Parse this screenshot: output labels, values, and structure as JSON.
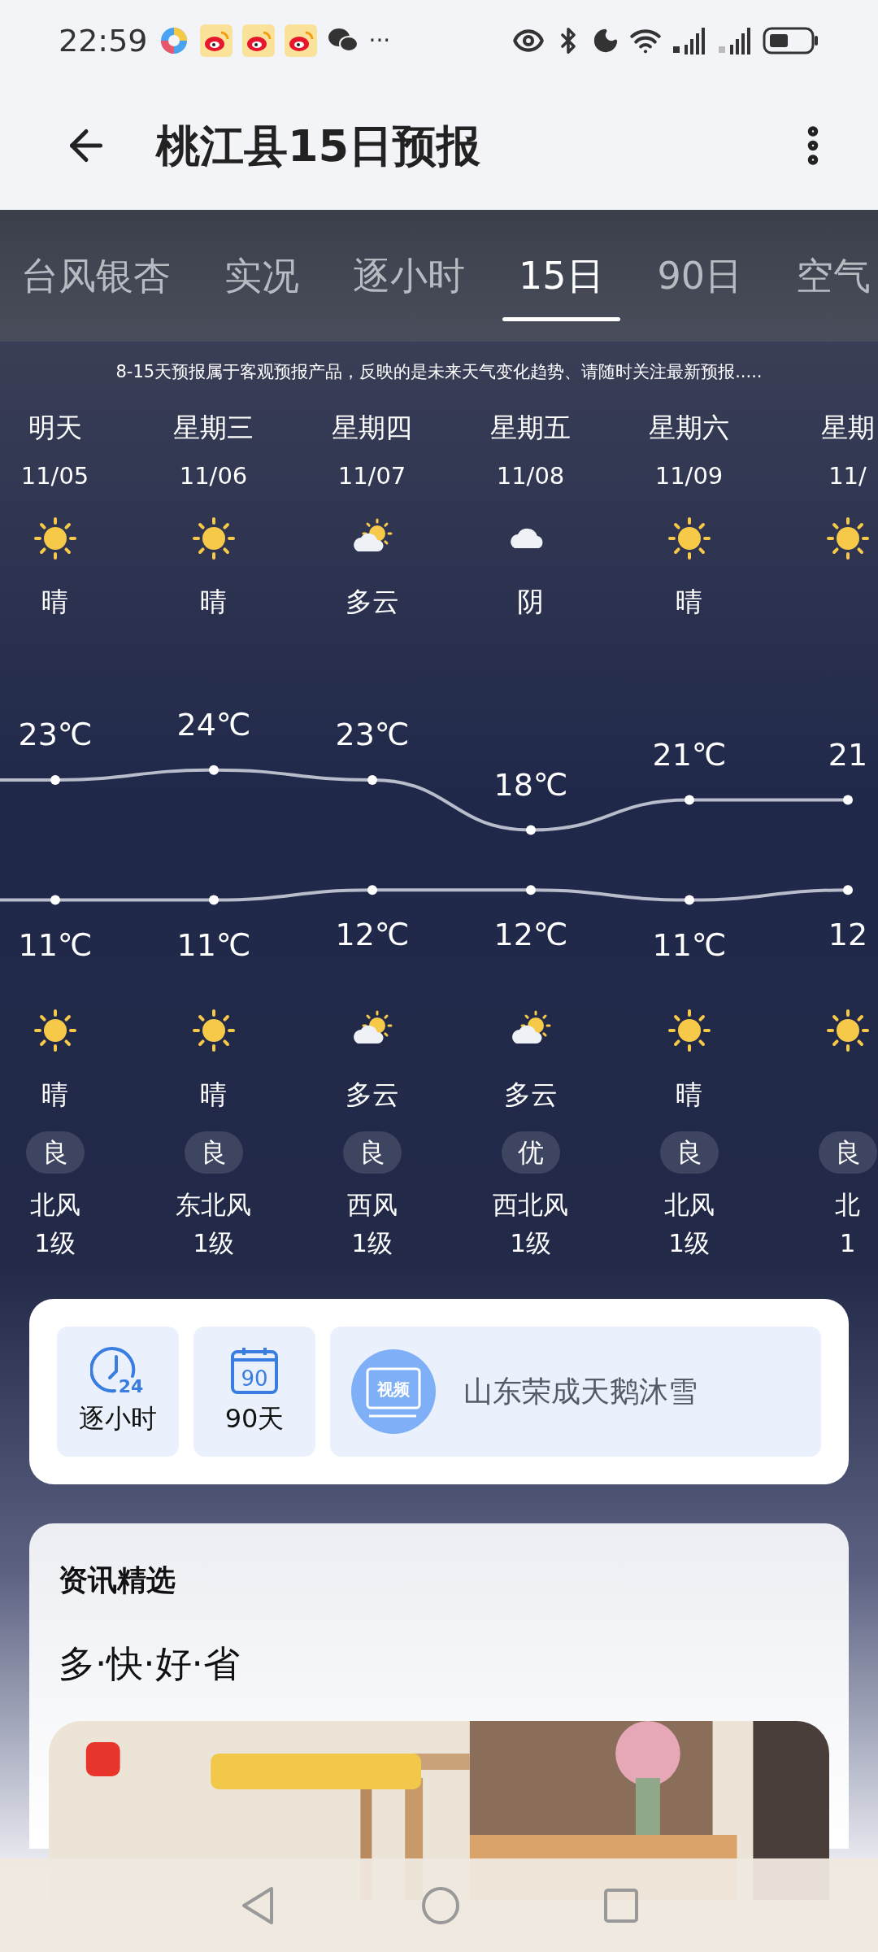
{
  "status_bar": {
    "time": "22:59",
    "more": "···"
  },
  "header": {
    "title": "桃江县15日预报"
  },
  "tabs": [
    {
      "label": "台风银杏",
      "selected": false
    },
    {
      "label": "实况",
      "selected": false
    },
    {
      "label": "逐小时",
      "selected": false
    },
    {
      "label": "15日",
      "selected": true
    },
    {
      "label": "90日",
      "selected": false
    },
    {
      "label": "空气",
      "selected": false
    }
  ],
  "notice": "8-15天预报属于客观预报产品，反映的是未来天气变化趋势、请随时关注最新预报.....",
  "days": [
    {
      "day": "明天",
      "date": "11/05",
      "daytime": {
        "kind": "sunny",
        "condition": "晴"
      },
      "high": "23℃",
      "low": "11℃",
      "night": {
        "kind": "sunny",
        "condition": "晴"
      },
      "aqi": "良",
      "wind": "北风",
      "wind_level": "1级"
    },
    {
      "day": "星期三",
      "date": "11/06",
      "daytime": {
        "kind": "sunny",
        "condition": "晴"
      },
      "high": "24℃",
      "low": "11℃",
      "night": {
        "kind": "sunny",
        "condition": "晴"
      },
      "aqi": "良",
      "wind": "东北风",
      "wind_level": "1级"
    },
    {
      "day": "星期四",
      "date": "11/07",
      "daytime": {
        "kind": "partly",
        "condition": "多云"
      },
      "high": "23℃",
      "low": "12℃",
      "night": {
        "kind": "partly",
        "condition": "多云"
      },
      "aqi": "良",
      "wind": "西风",
      "wind_level": "1级"
    },
    {
      "day": "星期五",
      "date": "11/08",
      "daytime": {
        "kind": "overcast",
        "condition": "阴"
      },
      "high": "18℃",
      "low": "12℃",
      "night": {
        "kind": "partly",
        "condition": "多云"
      },
      "aqi": "优",
      "wind": "西北风",
      "wind_level": "1级"
    },
    {
      "day": "星期六",
      "date": "11/09",
      "daytime": {
        "kind": "sunny",
        "condition": "晴"
      },
      "high": "21℃",
      "low": "11℃",
      "night": {
        "kind": "sunny",
        "condition": "晴"
      },
      "aqi": "良",
      "wind": "北风",
      "wind_level": "1级"
    },
    {
      "day": "星期",
      "date": "11/",
      "daytime": {
        "kind": "sunny"
      },
      "high": "21",
      "low": "12",
      "night": {
        "kind": "sunny"
      },
      "aqi": "良",
      "wind": "北",
      "wind_level": "1"
    }
  ],
  "shortcuts": [
    {
      "kind": "hourly",
      "label": "逐小时",
      "badge": "24"
    },
    {
      "kind": "calendar",
      "label": "90天",
      "badge": "90"
    }
  ],
  "video": {
    "badge": "视频",
    "title": "山东荣成天鹅沐雪"
  },
  "news": {
    "title": "资讯精选",
    "subtitle": "多·快·好·省"
  }
}
